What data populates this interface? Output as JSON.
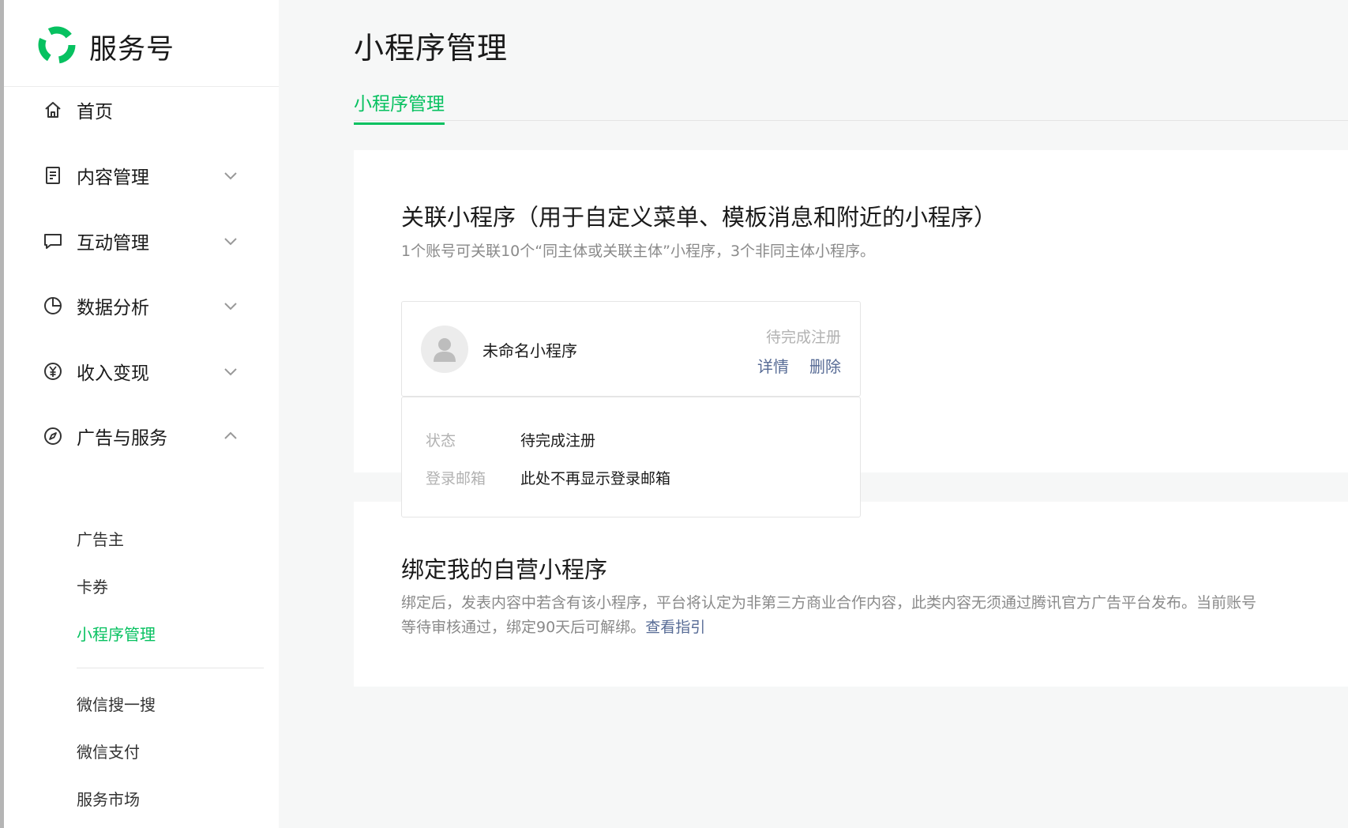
{
  "brand": {
    "name": "服务号",
    "accent": "#07c160"
  },
  "sidebar": {
    "items": [
      {
        "label": "首页",
        "icon": "home-icon"
      },
      {
        "label": "内容管理",
        "icon": "document-icon"
      },
      {
        "label": "互动管理",
        "icon": "chat-icon"
      },
      {
        "label": "数据分析",
        "icon": "pie-chart-icon"
      },
      {
        "label": "收入变现",
        "icon": "yen-icon"
      },
      {
        "label": "广告与服务",
        "icon": "compass-icon"
      }
    ],
    "sub_items": [
      {
        "label": "广告主"
      },
      {
        "label": "卡券"
      },
      {
        "label": "小程序管理",
        "active": true
      },
      {
        "label": "微信搜一搜"
      },
      {
        "label": "微信支付"
      },
      {
        "label": "服务市场"
      }
    ]
  },
  "header": {
    "title": "小程序管理"
  },
  "tabs": [
    {
      "label": "小程序管理",
      "active": true
    }
  ],
  "linked": {
    "title": "关联小程序（用于自定义菜单、模板消息和附近的小程序）",
    "desc": "1个账号可关联10个“同主体或关联主体”小程序，3个非同主体小程序。",
    "app": {
      "name": "未命名小程序",
      "status": "待完成注册",
      "action_detail": "详情",
      "action_delete": "删除"
    },
    "details": [
      {
        "key": "状态",
        "value": "待完成注册"
      },
      {
        "key": "登录邮箱",
        "value": "此处不再显示登录邮箱"
      }
    ]
  },
  "bind": {
    "title": "绑定我的自营小程序",
    "desc_line1": "绑定后，发表内容中若含有该小程序，平台将认定为非第三方商业合作内容，此类内容无须通过腾讯官方广告平台发布。当前账号",
    "desc_line2": "等待审核通过，绑定90天后可解绑。",
    "guide_link": "查看指引"
  },
  "colors": {
    "link": "#576b95",
    "muted": "#b2b2b2",
    "accent": "#07c160"
  }
}
